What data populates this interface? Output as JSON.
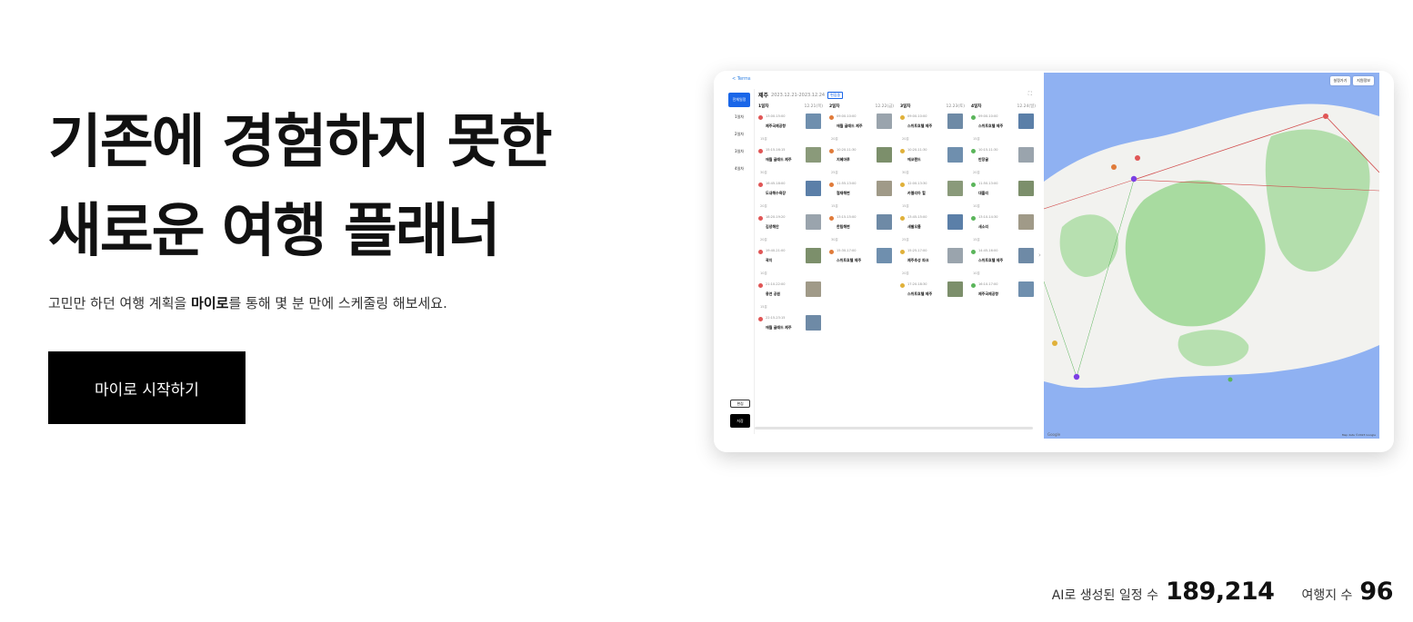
{
  "hero": {
    "title_line1": "기존에 경험하지 못한",
    "title_line2": "새로운 여행 플래너",
    "subtitle_before": "고민만 하던 여행 계획을 ",
    "subtitle_bold": "마이로",
    "subtitle_after": "를 통해 몇 분 만에 스케줄링 해보세요.",
    "cta_label": "마이로 시작하기"
  },
  "stats": {
    "schedules_label": "AI로 생성된 일정 수",
    "schedules_value": "189,214",
    "destinations_label": "여행지 수",
    "destinations_value": "96"
  },
  "preview": {
    "back_link": "< Terms",
    "sidebar": [
      "전체일정",
      "1일차",
      "2일차",
      "3일차",
      "4일차"
    ],
    "edit_button": "편집",
    "save_button": "저장",
    "city": "제주",
    "dates": "2023.12.21-2023.12.24",
    "badge": "편집중",
    "columns": [
      {
        "day": "1일차",
        "dist": "12.21(목)",
        "stops": [
          {
            "time": "13:00-15:00",
            "name": "제주국제공항",
            "gap": "15분"
          },
          {
            "time": "15:15-16:15",
            "name": "애월 글래드 제주",
            "gap": "30분"
          },
          {
            "time": "16:45-18:00",
            "name": "도내해수욕장",
            "gap": "20분"
          },
          {
            "time": "18:20-19:20",
            "name": "김녕해안",
            "gap": "20분"
          },
          {
            "time": "19:40-21:00",
            "name": "곽지",
            "gap": "10분"
          },
          {
            "time": "21:10-22:00",
            "name": "용연 공원",
            "gap": "15분"
          },
          {
            "time": "22:15-23:15",
            "name": "애월 글래드 제주",
            "gap": ""
          }
        ]
      },
      {
        "day": "2일차",
        "dist": "12.22(금)",
        "stops": [
          {
            "time": "09:00-10:00",
            "name": "애월 글래드 제주",
            "gap": "20분"
          },
          {
            "time": "10:20-11:30",
            "name": "지혜마루",
            "gap": "25분"
          },
          {
            "time": "11:55-13:00",
            "name": "협재해변",
            "gap": "15분"
          },
          {
            "time": "13:15-15:00",
            "name": "한림해변",
            "gap": "30분"
          },
          {
            "time": "15:30-17:00",
            "name": "스위트호텔 제주",
            "gap": ""
          }
        ]
      },
      {
        "day": "3일차",
        "dist": "12.23(토)",
        "stops": [
          {
            "time": "09:00-10:00",
            "name": "스위트호텔 제주",
            "gap": "20분"
          },
          {
            "time": "10:20-11:30",
            "name": "에코랜드",
            "gap": "30분"
          },
          {
            "time": "12:00-13:30",
            "name": "카멜리아 힐",
            "gap": "15분"
          },
          {
            "time": "13:45-15:00",
            "name": "새별오름",
            "gap": "25분"
          },
          {
            "time": "15:25-17:00",
            "name": "제주추성 파크",
            "gap": "20분"
          },
          {
            "time": "17:20-18:30",
            "name": "스위트호텔 제주",
            "gap": ""
          }
        ]
      },
      {
        "day": "4일차",
        "dist": "12.24(일)",
        "stops": [
          {
            "time": "09:00-10:00",
            "name": "스위트호텔 제주",
            "gap": "15분"
          },
          {
            "time": "10:15-11:30",
            "name": "만장굴",
            "gap": "20분"
          },
          {
            "time": "11:50-13:00",
            "name": "대흘리",
            "gap": "10분"
          },
          {
            "time": "13:10-14:30",
            "name": "새소리",
            "gap": "15분"
          },
          {
            "time": "14:45-16:00",
            "name": "스위트호텔 제주",
            "gap": "10분"
          },
          {
            "time": "16:10-17:00",
            "name": "제주국제공항",
            "gap": ""
          }
        ]
      }
    ],
    "map_buttons": [
      "설정가기",
      "지원정보"
    ],
    "map_footer": "Map data ©2023 Google",
    "map_logo": "Google"
  },
  "colors": {
    "cta_bg": "#000000",
    "accent_blue": "#1a66e8",
    "map_sea": "#8fb1f2",
    "map_land": "#f2f2ef",
    "map_park": "#a8dba0",
    "route_red": "#d14b4b",
    "day1": "#e05656",
    "day2": "#e07b3a",
    "day3": "#e0b13a",
    "day4": "#5bb55b"
  }
}
